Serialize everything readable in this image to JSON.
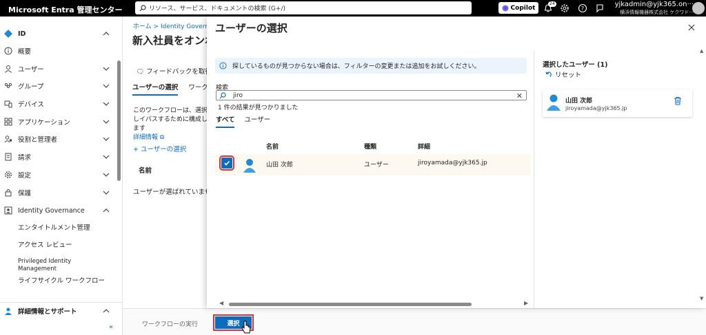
{
  "topbar": {
    "brand": "Microsoft Entra 管理センター",
    "search_placeholder": "リソース、サービス、ドキュメントの検索 (G+/)",
    "copilot_label": "Copilot",
    "notif_badge": "24",
    "account_user": "yjkadmin@yjk365.on···",
    "account_org": "横浜情報機器株式会社  ケクワド···"
  },
  "sidebar": {
    "items": [
      {
        "label": "ID",
        "icon": "diamond-icon"
      },
      {
        "label": "概要",
        "icon": "info-icon"
      },
      {
        "label": "ユーザー",
        "icon": "person-icon"
      },
      {
        "label": "グループ",
        "icon": "group-icon"
      },
      {
        "label": "デバイス",
        "icon": "device-icon"
      },
      {
        "label": "アプリケーション",
        "icon": "apps-icon"
      },
      {
        "label": "役割と管理者",
        "icon": "role-icon"
      },
      {
        "label": "請求",
        "icon": "billing-icon"
      },
      {
        "label": "設定",
        "icon": "gear-icon"
      },
      {
        "label": "保護",
        "icon": "lock-icon"
      },
      {
        "label": "Identity Governance",
        "icon": "governance-icon"
      }
    ],
    "subitems": [
      "エンタイトルメント管理",
      "アクセス レビュー",
      "Privileged Identity Management",
      "ライフサイクル ワークフロー"
    ],
    "help_label": "詳細情報とサポート",
    "collapse_label": "«"
  },
  "background": {
    "breadcrumb": "ホーム  >  Identity Governa",
    "title": "新入社員をオンボ",
    "feedback": "フィードバックを取得",
    "tab_selected": "ユーザーの選択",
    "tab_other": "ワーク",
    "description": "このワークフローは、選択しイパスするために構成します",
    "more_info": "詳細情報",
    "add_user": "+ ユーザーの選択",
    "column_name": "名前",
    "empty_text": "ユーザーが選ばれていません",
    "run_workflow": "ワークフローの実行"
  },
  "dialog": {
    "title": "ユーザーの選択",
    "info_text": "探しているものが見つからない場合は、フィルターの変更または追加をお試しください。",
    "search_label": "検索",
    "search_value": "jiro",
    "result_count": "1 件の結果が見つかりました",
    "tabs": [
      "すべて",
      "ユーザー"
    ],
    "columns": [
      "名前",
      "種類",
      "詳細"
    ],
    "rows": [
      {
        "name": "山田 次郎",
        "type": "ユーザー",
        "detail": "jiroyamada@yjk365.jp",
        "checked": true
      }
    ],
    "selected_title": "選択したユーザー (1)",
    "reset_label": "リセット",
    "selected_users": [
      {
        "name": "山田 次郎",
        "email": "jiroyamada@yjk365.jp"
      }
    ],
    "select_button": "選択"
  },
  "colors": {
    "accent": "#0f6cbd",
    "highlight": "#d13438"
  }
}
